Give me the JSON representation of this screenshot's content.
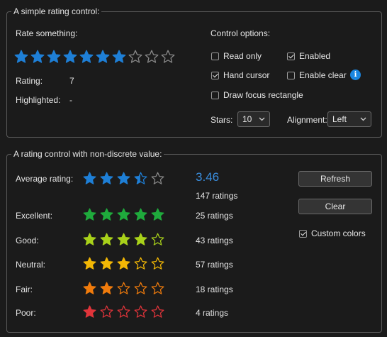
{
  "group1": {
    "title": "A simple rating control:",
    "rate_label": "Rate something:",
    "rating_label": "Rating:",
    "rating_value": "7",
    "highlighted_label": "Highlighted:",
    "highlighted_value": "-",
    "stars": {
      "value": 7,
      "max": 10,
      "color": "#1e7fd6"
    }
  },
  "options": {
    "title": "Control options:",
    "read_only": {
      "label": "Read only",
      "checked": false
    },
    "enabled": {
      "label": "Enabled",
      "checked": true
    },
    "hand_cursor": {
      "label": "Hand cursor",
      "checked": true
    },
    "enable_clear": {
      "label": "Enable clear",
      "checked": false
    },
    "draw_focus": {
      "label": "Draw focus rectangle",
      "checked": false
    },
    "stars_label": "Stars:",
    "stars_value": "10",
    "alignment_label": "Alignment:",
    "alignment_value": "Left",
    "info_icon": "i"
  },
  "group2": {
    "title": "A rating control with non-discrete value:",
    "average_label": "Average rating:",
    "average_value": "3.46",
    "average_color": "#3a8fe0",
    "average_stars": 3.46,
    "average_star_color": "#1e7fd6",
    "total_ratings": "147 ratings",
    "rows": [
      {
        "label": "Excellent:",
        "stars": 5,
        "color": "#1faa3c",
        "count": "25 ratings"
      },
      {
        "label": "Good:",
        "stars": 4,
        "color": "#a8d11a",
        "count": "43 ratings"
      },
      {
        "label": "Neutral:",
        "stars": 3,
        "color": "#f2b705",
        "count": "57 ratings"
      },
      {
        "label": "Fair:",
        "stars": 2,
        "color": "#f07b0c",
        "count": "18 ratings"
      },
      {
        "label": "Poor:",
        "stars": 1,
        "color": "#e0343a",
        "count": "4 ratings"
      }
    ],
    "refresh_label": "Refresh",
    "clear_label": "Clear",
    "custom_colors": {
      "label": "Custom colors",
      "checked": true
    }
  }
}
